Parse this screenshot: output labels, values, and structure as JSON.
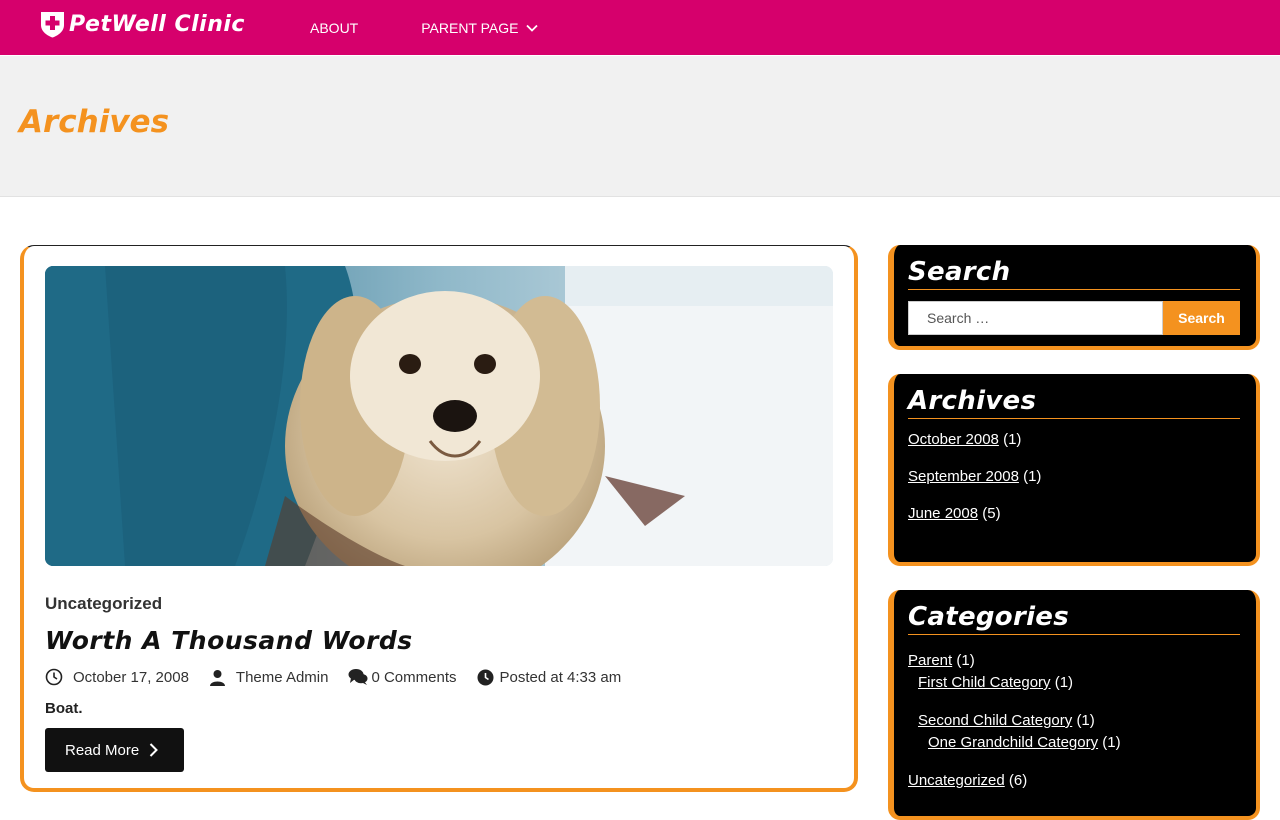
{
  "header": {
    "logo_text": "PetWell Clinic",
    "nav": [
      {
        "label": "ABOUT"
      },
      {
        "label": "PARENT PAGE"
      }
    ]
  },
  "banner": {
    "title": "Archives"
  },
  "post": {
    "category": "Uncategorized",
    "title": "Worth A Thousand Words",
    "date": "October 17, 2008",
    "author": "Theme Admin",
    "comments": "0 Comments",
    "posted_at": "Posted at 4:33 am",
    "excerpt": "Boat.",
    "read_more": "Read More"
  },
  "sidebar": {
    "search": {
      "title": "Search",
      "placeholder": "Search …",
      "button": "Search"
    },
    "archives": {
      "title": "Archives",
      "items": [
        {
          "label": "October 2008",
          "count": "(1)"
        },
        {
          "label": "September 2008",
          "count": "(1)"
        },
        {
          "label": "June 2008",
          "count": "(5)"
        }
      ]
    },
    "categories": {
      "title": "Categories",
      "items": [
        {
          "label": "Parent",
          "count": "(1)"
        },
        {
          "label": "First Child Category",
          "count": "(1)"
        },
        {
          "label": "Second Child Category",
          "count": "(1)"
        },
        {
          "label": "One Grandchild Category",
          "count": "(1)"
        },
        {
          "label": "Uncategorized",
          "count": "(6)"
        }
      ]
    }
  },
  "colors": {
    "brand": "#d6006c",
    "accent": "#f4921f",
    "widget_bg": "#000000"
  },
  "icons": [
    "shield-cross-icon",
    "chevron-down-icon",
    "clock-icon",
    "user-icon",
    "comments-icon",
    "chevron-right-icon"
  ]
}
